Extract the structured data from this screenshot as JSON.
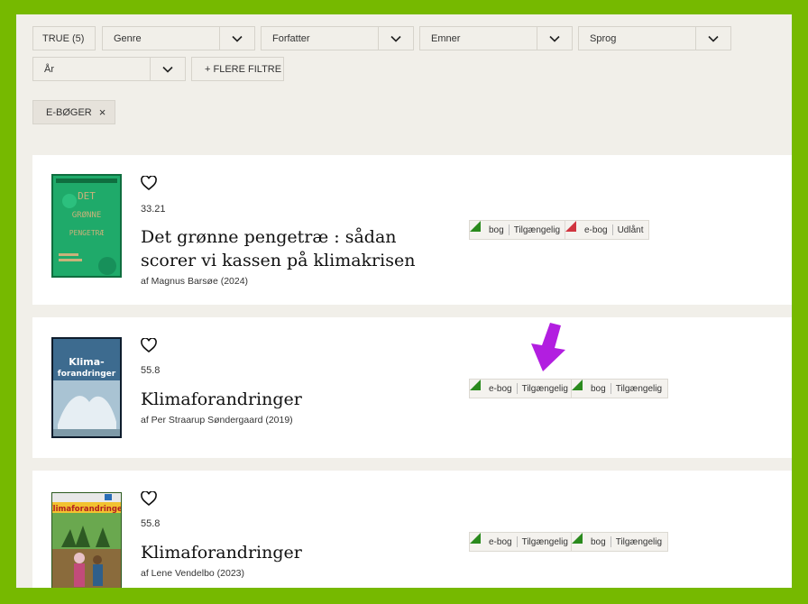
{
  "filters": {
    "row1": [
      {
        "label": "TRUE (5)"
      },
      {
        "label": "Genre"
      },
      {
        "label": "Forfatter"
      },
      {
        "label": "Emner"
      },
      {
        "label": "Sprog"
      }
    ],
    "year_label": "År",
    "more_label": "+ FLERE FILTRE",
    "active_label": "E-BØGER",
    "remove_symbol": "×"
  },
  "results": [
    {
      "score": "33.21",
      "title": "Det grønne pengetræ : sådan scorer vi kassen på klimakrisen",
      "author": "af Magnus Barsøe (2024)",
      "cover_text": [
        "DET",
        "GRØNNE",
        "PENGETRÆ"
      ],
      "cover_color": "#1faa6a",
      "badges": [
        {
          "type": "bog",
          "status": "Tilgængelig",
          "color": "#2a8a1d"
        },
        {
          "type": "e-bog",
          "status": "Udlånt",
          "color": "#d0343f"
        }
      ]
    },
    {
      "score": "55.8",
      "title": "Klimaforandringer",
      "author": "af Per Straarup Søndergaard (2019)",
      "cover_text": [
        "Klima-",
        "forandringer"
      ],
      "cover_color": "#1d3550",
      "badges": [
        {
          "type": "e-bog",
          "status": "Tilgængelig",
          "color": "#2a8a1d"
        },
        {
          "type": "bog",
          "status": "Tilgængelig",
          "color": "#2a8a1d"
        }
      ]
    },
    {
      "score": "55.8",
      "title": "Klimaforandringer",
      "author": "af Lene Vendelbo (2023)",
      "cover_text": [
        "Klimaforandringer"
      ],
      "cover_color": "#3f7a2e",
      "badges": [
        {
          "type": "e-bog",
          "status": "Tilgængelig",
          "color": "#2a8a1d"
        },
        {
          "type": "bog",
          "status": "Tilgængelig",
          "color": "#2a8a1d"
        }
      ]
    }
  ],
  "annotation": {
    "arrow_color": "#b21ee0"
  }
}
